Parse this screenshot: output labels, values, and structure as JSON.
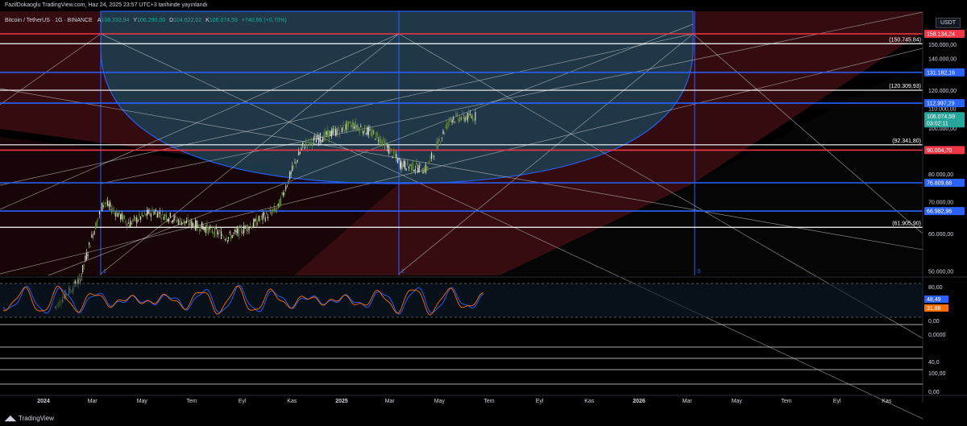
{
  "header": {
    "published": "FazilDokaoglu TradingView.com, Haz 24, 2025 23:57 UTC+3 tarihinde yayınlandı",
    "symbol": "Bitcoin / TetherUS · 1G · BINANCE",
    "ohlc_open_label": "A",
    "ohlc_open": "108.333,94",
    "ohlc_high_label": "Y",
    "ohlc_high": "106.290,00",
    "ohlc_low_label": "D",
    "ohlc_low": "104.622,02",
    "ohlc_close_label": "K",
    "ohlc_close": "106.074,59",
    "ohlc_change": "+740,66 (+0,70%)"
  },
  "currency_label": "USDT",
  "colors": {
    "background": "#000000",
    "red_level": "#f23645",
    "blue_level": "#2962ff",
    "white_level": "#ffffff",
    "ellipse_fill": "#1e3a4a",
    "red_zone": "#3a0d12",
    "price_label_green": "#26a69a",
    "rsi_blue": "#2962ff",
    "rsi_orange": "#ff6d00"
  },
  "price_axis_ticks": [
    "150.000,00",
    "140.000,00",
    "120.000,00",
    "110.000,00",
    "100.000,00",
    "80.000,00",
    "70.000,00",
    "60.000,00",
    "50.000,00"
  ],
  "level_labels": [
    {
      "text": "158.134,24",
      "price": 158134.24,
      "style": "red-box"
    },
    {
      "text": "(150.745,84)",
      "price": 150745.84,
      "style": "white-text"
    },
    {
      "text": "131.182,16",
      "price": 131182.16,
      "style": "blue-box"
    },
    {
      "text": "(120.309,93)",
      "price": 120309.93,
      "style": "white-text"
    },
    {
      "text": "112.997,29",
      "price": 112997.29,
      "style": "blue-box"
    },
    {
      "text": "(92.341,80)",
      "price": 92341.8,
      "style": "white-text"
    },
    {
      "text": "90.004,70",
      "price": 90004.7,
      "style": "red-box"
    },
    {
      "text": "76.809,68",
      "price": 76809.68,
      "style": "blue-box"
    },
    {
      "text": "66.982,96",
      "price": 66982.96,
      "style": "blue-box"
    },
    {
      "text": "(61.905,90)",
      "price": 61905.9,
      "style": "white-text"
    }
  ],
  "current_price": {
    "value": "106.074,59",
    "countdown": "03:02:11",
    "price": 106074.59
  },
  "rsi_panel": {
    "ticks": [
      "80,00",
      "0,00"
    ],
    "value1": "48,49",
    "value2": "31,88"
  },
  "lower_panel_ticks": [
    "0,0000",
    "40,0",
    "100,00",
    "0,00"
  ],
  "time_axis": [
    "2024",
    "Mar",
    "May",
    "Tem",
    "Eyl",
    "Kas",
    "2025",
    "Mar",
    "May",
    "Tem",
    "Eyl",
    "Kas",
    "2026",
    "Mar",
    "May",
    "Tem",
    "Eyl",
    "Kas"
  ],
  "cycle_markers": [
    "1",
    "2",
    "3"
  ],
  "footer_brand": "TradingView",
  "chart_data": {
    "type": "line",
    "title": "Bitcoin / TetherUS · 1G · BINANCE",
    "xlabel": "",
    "ylabel": "USDT",
    "ylim": [
      48000,
      170000
    ],
    "x": [
      "2024-01",
      "2024-02",
      "2024-03",
      "2024-04",
      "2024-05",
      "2024-06",
      "2024-07",
      "2024-08",
      "2024-09",
      "2024-10",
      "2024-11",
      "2024-12",
      "2025-01",
      "2025-02",
      "2025-03",
      "2025-04",
      "2025-05",
      "2025-06"
    ],
    "series": [
      {
        "values": [
          42000,
          48000,
          70000,
          63000,
          67000,
          64000,
          62000,
          59000,
          63000,
          68000,
          92000,
          97000,
          102000,
          96000,
          84000,
          82000,
          105000,
          106000
        ]
      }
    ],
    "horizontal_levels": [
      158134.24,
      150745.84,
      131182.16,
      120309.93,
      112997.29,
      92341.8,
      90004.7,
      76809.68,
      66982.96,
      61905.9
    ]
  }
}
